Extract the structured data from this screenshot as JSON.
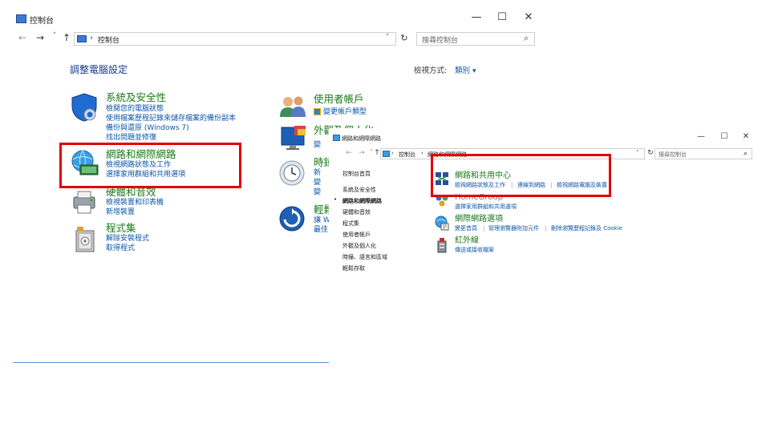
{
  "window": {
    "title": "控制台",
    "minimize": "—",
    "maximize": "☐",
    "close": "✕"
  },
  "toolbar": {
    "back": "←",
    "forward": "→",
    "dropdown": "˅",
    "up": "↑",
    "address_separator": "›",
    "address": "控制台",
    "address_dropdown": "˅",
    "refresh": "↻",
    "search_placeholder": "搜尋控制台",
    "search_glyph": "⌕"
  },
  "main": {
    "heading": "調整電腦設定",
    "view_by_label": "檢視方式:",
    "view_by_value": "類別",
    "view_by_arrow": "▾",
    "categories": [
      {
        "title": "系統及安全性",
        "links": [
          "檢閱您的電腦狀態",
          "使用檔案歷程記錄來儲存檔案的備份副本",
          "備份與還原 (Windows 7)",
          "找出問題並修復"
        ]
      },
      {
        "title": "網路和網際網路",
        "links": [
          "檢視網路狀態及工作",
          "選擇家用群組和共用選項"
        ]
      },
      {
        "title": "硬體和音效",
        "links": [
          "檢視裝置和印表機",
          "新增裝置"
        ]
      },
      {
        "title": "程式集",
        "links": [
          "解除安裝程式",
          "取得程式"
        ]
      },
      {
        "title": "使用者帳戶",
        "links": [
          "變更帳戶類型"
        ]
      },
      {
        "title": "外觀及個人化",
        "links": [
          "變"
        ]
      },
      {
        "title": "時鐘",
        "links": [
          "新",
          "變",
          "變"
        ]
      },
      {
        "title": "輕鬆",
        "links": [
          "讓 W",
          "最佳"
        ]
      }
    ]
  },
  "win2": {
    "title": "網路和網際網路",
    "minimize": "—",
    "maximize": "☐",
    "close": "✕",
    "back": "←",
    "forward": "→",
    "dropdown": "˅",
    "up": "↑",
    "address_crumb_1": "控制台",
    "address_crumb_sep": "›",
    "address_crumb_2": "網路和網際網路",
    "address_dropdown": "˅",
    "refresh": "↻",
    "search_placeholder": "搜尋控制台",
    "search_glyph": "⌕",
    "nav": [
      "控制台首頁",
      "系統及安全性",
      "網路和網際網路",
      "硬體和音效",
      "程式集",
      "使用者帳戶",
      "外觀及個人化",
      "時鐘、語言和區域",
      "輕鬆存取"
    ],
    "nav_bullet": "•",
    "sections": [
      {
        "title": "網路和共用中心",
        "links": [
          "檢視網路狀態及工作",
          "連線到網路",
          "檢視網路電腦及裝置"
        ]
      },
      {
        "title": "HomeGroup",
        "links": [
          "選擇家用群組和共用選項"
        ]
      },
      {
        "title": "網際網路選項",
        "links": [
          "變更首頁",
          "管理瀏覽器附加元件",
          "刪除瀏覽歷程記錄及 Cookie"
        ]
      },
      {
        "title": "紅外線",
        "links": [
          "傳送或接收檔案"
        ]
      }
    ],
    "link_separator": "|"
  }
}
